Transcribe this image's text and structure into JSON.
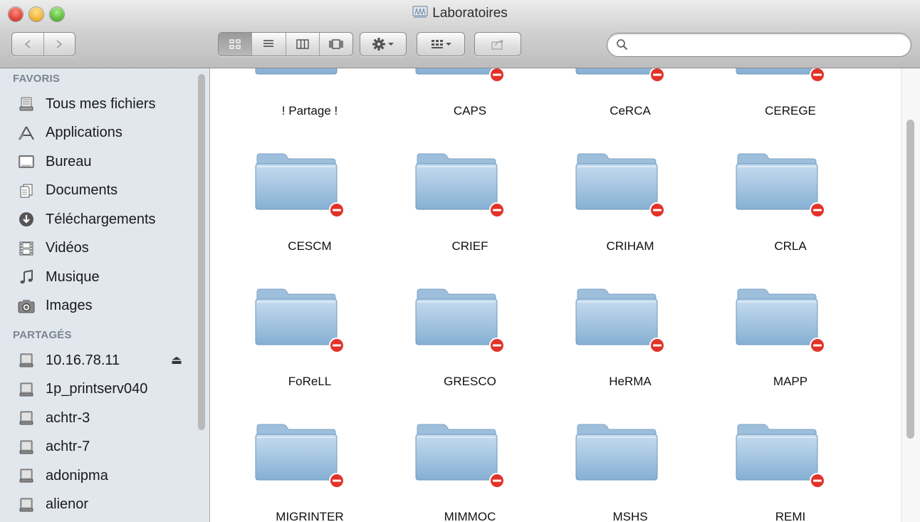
{
  "window": {
    "title": "Laboratoires"
  },
  "toolbar": {
    "search_placeholder": "",
    "view_modes": [
      "icons-icon",
      "list-icon",
      "columns-icon",
      "coverflow-icon"
    ],
    "action_icon": "gear-icon",
    "arrange_icon": "arrange-grid-icon",
    "share_icon": "share-icon"
  },
  "sidebar": {
    "favorites_header": "FAVORIS",
    "favorites": [
      {
        "label": "Tous mes fichiers",
        "icon": "all-files-icon"
      },
      {
        "label": "Applications",
        "icon": "applications-icon"
      },
      {
        "label": "Bureau",
        "icon": "desktop-icon"
      },
      {
        "label": "Documents",
        "icon": "documents-icon"
      },
      {
        "label": "Téléchargements",
        "icon": "downloads-icon"
      },
      {
        "label": "Vidéos",
        "icon": "movies-icon"
      },
      {
        "label": "Musique",
        "icon": "music-icon"
      },
      {
        "label": "Images",
        "icon": "camera-icon"
      }
    ],
    "shared_header": "PARTAGÉS",
    "shared": [
      {
        "label": "10.16.78.11",
        "icon": "server-icon",
        "eject": true
      },
      {
        "label": "1p_printserv040",
        "icon": "server-icon"
      },
      {
        "label": "achtr-3",
        "icon": "server-icon"
      },
      {
        "label": "achtr-7",
        "icon": "server-icon"
      },
      {
        "label": "adonipma",
        "icon": "server-icon"
      },
      {
        "label": "alienor",
        "icon": "server-icon"
      }
    ]
  },
  "folders": [
    {
      "name": "! Partage !",
      "no_access": false
    },
    {
      "name": "CAPS",
      "no_access": true
    },
    {
      "name": "CeRCA",
      "no_access": true
    },
    {
      "name": "CEREGE",
      "no_access": true
    },
    {
      "name": "CESCM",
      "no_access": true
    },
    {
      "name": "CRIEF",
      "no_access": true
    },
    {
      "name": "CRIHAM",
      "no_access": true
    },
    {
      "name": "CRLA",
      "no_access": true
    },
    {
      "name": "FoReLL",
      "no_access": true
    },
    {
      "name": "GRESCO",
      "no_access": true
    },
    {
      "name": "HeRMA",
      "no_access": true
    },
    {
      "name": "MAPP",
      "no_access": true
    },
    {
      "name": "MIGRINTER",
      "no_access": true
    },
    {
      "name": "MIMMOC",
      "no_access": true
    },
    {
      "name": "MSHS",
      "no_access": false
    },
    {
      "name": "REMI",
      "no_access": true
    }
  ],
  "colors": {
    "sidebar_bg": "#e2e7ee",
    "folder_blue": "#9ec3df",
    "no_access_red": "#e2332a"
  }
}
